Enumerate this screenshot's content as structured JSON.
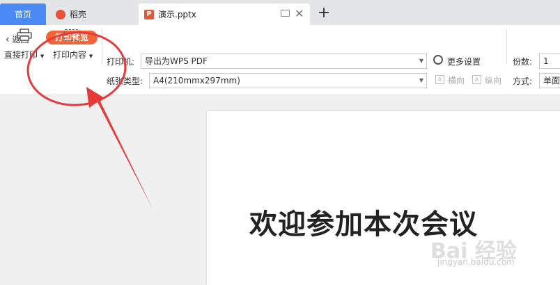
{
  "tabs": {
    "home": "首页",
    "daoke": "稻壳",
    "document": "演示.pptx",
    "document_icon": "P",
    "add": "+"
  },
  "toolbar": {
    "back": "返回",
    "mode_badge": "打印预览",
    "direct_print": "直接打印",
    "print_content": "打印内容",
    "printer_label": "打印机:",
    "printer_value": "导出为WPS PDF",
    "paper_label": "纸张类型:",
    "paper_value": "A4(210mmx297mm)",
    "more_settings": "更多设置",
    "landscape": "横向",
    "portrait": "纵向",
    "copies_label": "份数:",
    "copies_value": "1",
    "method_label": "方式:",
    "method_value": "单面"
  },
  "slide": {
    "title": "欢迎参加本次会议"
  },
  "watermark": {
    "brand": "Bai 经验",
    "url": "jingyan.baidu.com"
  },
  "colors": {
    "home_tab": "#4a8af4",
    "badge": "#f46436",
    "annotation": "#e8393a"
  }
}
